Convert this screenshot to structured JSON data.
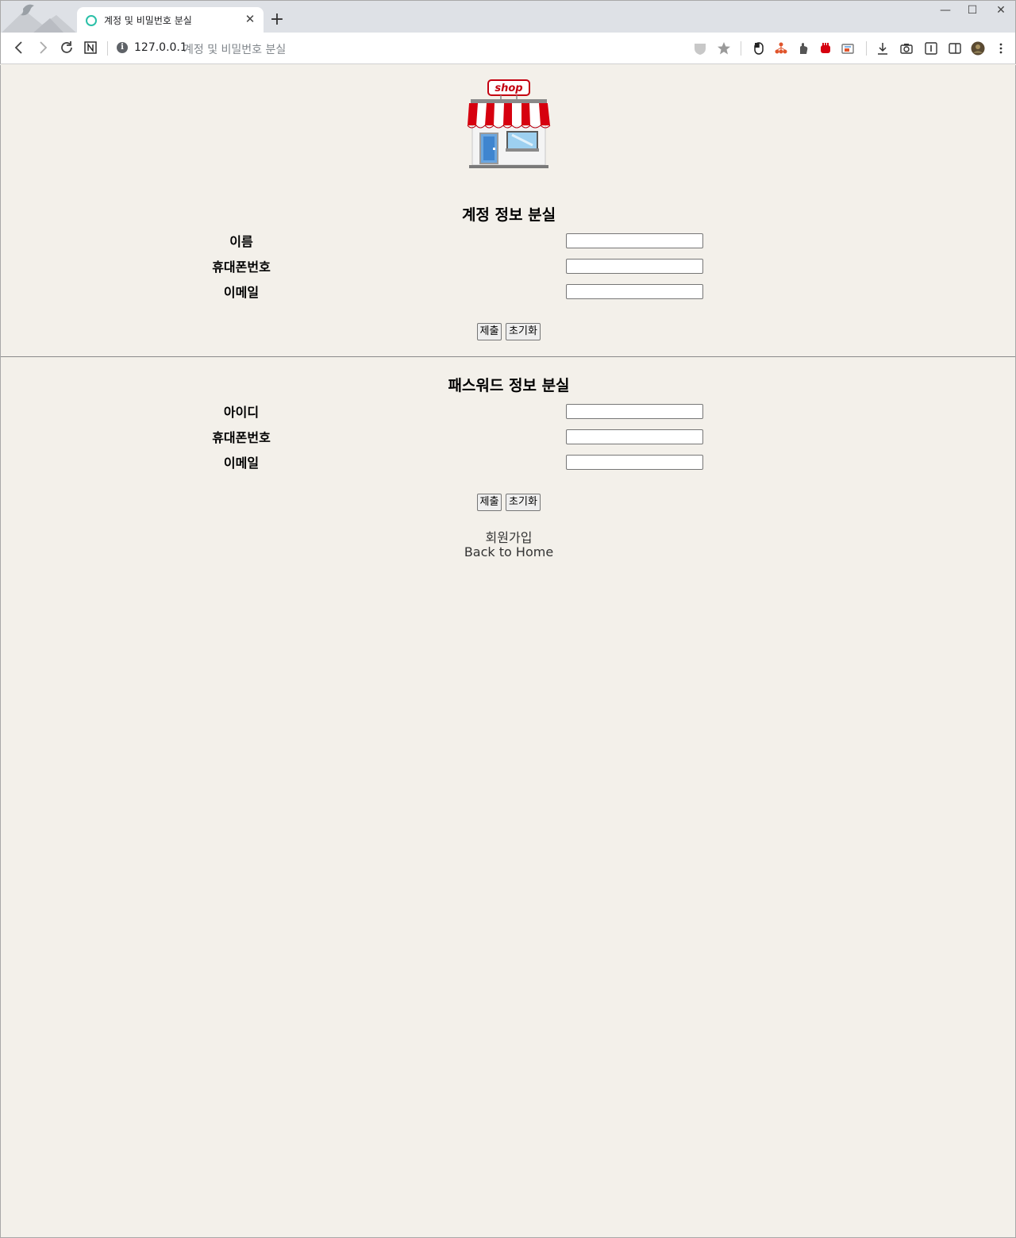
{
  "browser": {
    "tab_title": "계정 및 비밀번호 분실",
    "tab_close": "✕",
    "new_tab": "+",
    "url_host": "127.0.0.1",
    "url_title": "계정 및 비밀번호 분실",
    "window_controls": [
      "—",
      "☐",
      "✕"
    ]
  },
  "logo": {
    "sign_text": "shop"
  },
  "account_section": {
    "title": "계정 정보 분실",
    "fields": [
      {
        "label": "이름",
        "value": ""
      },
      {
        "label": "휴대폰번호",
        "value": ""
      },
      {
        "label": "이메일",
        "value": ""
      }
    ],
    "submit_label": "제출",
    "reset_label": "초기화"
  },
  "password_section": {
    "title": "패스워드 정보 분실",
    "fields": [
      {
        "label": "아이디",
        "value": ""
      },
      {
        "label": "휴대폰번호",
        "value": ""
      },
      {
        "label": "이메일",
        "value": ""
      }
    ],
    "submit_label": "제출",
    "reset_label": "초기화"
  },
  "links": {
    "signup": "회원가입",
    "back_home": "Back to Home"
  },
  "colors": {
    "page_background": "#f3f0ea",
    "awning_red": "#d6000f",
    "favicon_teal": "#2bc0a8"
  }
}
